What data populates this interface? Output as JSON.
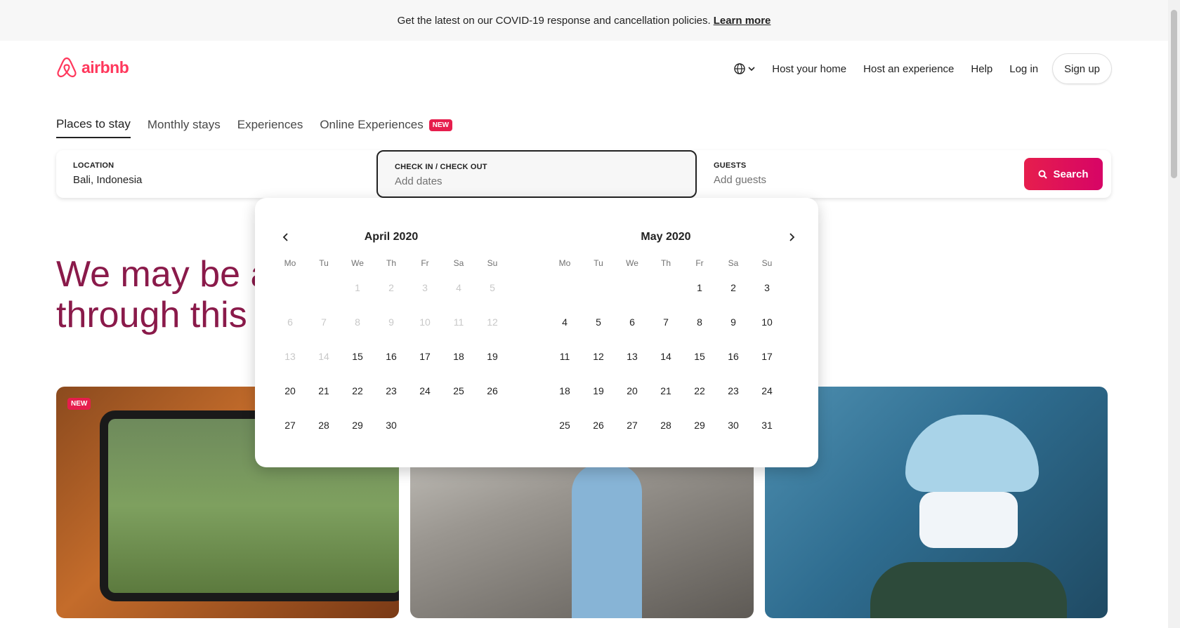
{
  "banner": {
    "text": "Get the latest on our COVID-19 response and cancellation policies.",
    "link": "Learn more"
  },
  "header": {
    "logo_text": "airbnb",
    "nav": [
      "Host your home",
      "Host an experience",
      "Help",
      "Log in"
    ],
    "signup": "Sign up",
    "brand_color": "#FF385C"
  },
  "tabs": [
    {
      "label": "Places to stay",
      "active": true
    },
    {
      "label": "Monthly stays",
      "active": false
    },
    {
      "label": "Experiences",
      "active": false
    },
    {
      "label": "Online Experiences",
      "active": false,
      "badge": "NEW"
    }
  ],
  "search": {
    "location": {
      "label": "LOCATION",
      "value": "Bali, Indonesia"
    },
    "dates": {
      "label": "CHECK IN / CHECK OUT",
      "placeholder": "Add dates"
    },
    "guests": {
      "label": "GUESTS",
      "placeholder": "Add guests"
    },
    "button": "Search",
    "accent": "#E61E4D"
  },
  "hero": {
    "line1": "We may be a",
    "line2": "through this t"
  },
  "cards": [
    {
      "badge": "NEW"
    },
    {},
    {}
  ],
  "calendar": {
    "weekdays": [
      "Mo",
      "Tu",
      "We",
      "Th",
      "Fr",
      "Sa",
      "Su"
    ],
    "months": [
      {
        "title": "April 2020",
        "days": [
          "",
          "",
          "1p",
          "2p",
          "3p",
          "4p",
          "5p",
          "6p",
          "7p",
          "8p",
          "9p",
          "10p",
          "11p",
          "12p",
          "13p",
          "14p",
          "15",
          "16",
          "17",
          "18",
          "19",
          "20",
          "21",
          "22",
          "23",
          "24",
          "25",
          "26",
          "27",
          "28",
          "29",
          "30",
          "",
          "",
          ""
        ]
      },
      {
        "title": "May 2020",
        "days": [
          "",
          "",
          "",
          "",
          "1",
          "2",
          "3",
          "4",
          "5",
          "6",
          "7",
          "8",
          "9",
          "10",
          "11",
          "12",
          "13",
          "14",
          "15",
          "16",
          "17",
          "18",
          "19",
          "20",
          "21",
          "22",
          "23",
          "24",
          "25",
          "26",
          "27",
          "28",
          "29",
          "30",
          "31"
        ]
      }
    ]
  },
  "icons": {
    "globe": "globe-icon",
    "chevron": "chevron-down-icon",
    "search": "search-icon",
    "prev": "chevron-left-icon",
    "next": "chevron-right-icon"
  }
}
